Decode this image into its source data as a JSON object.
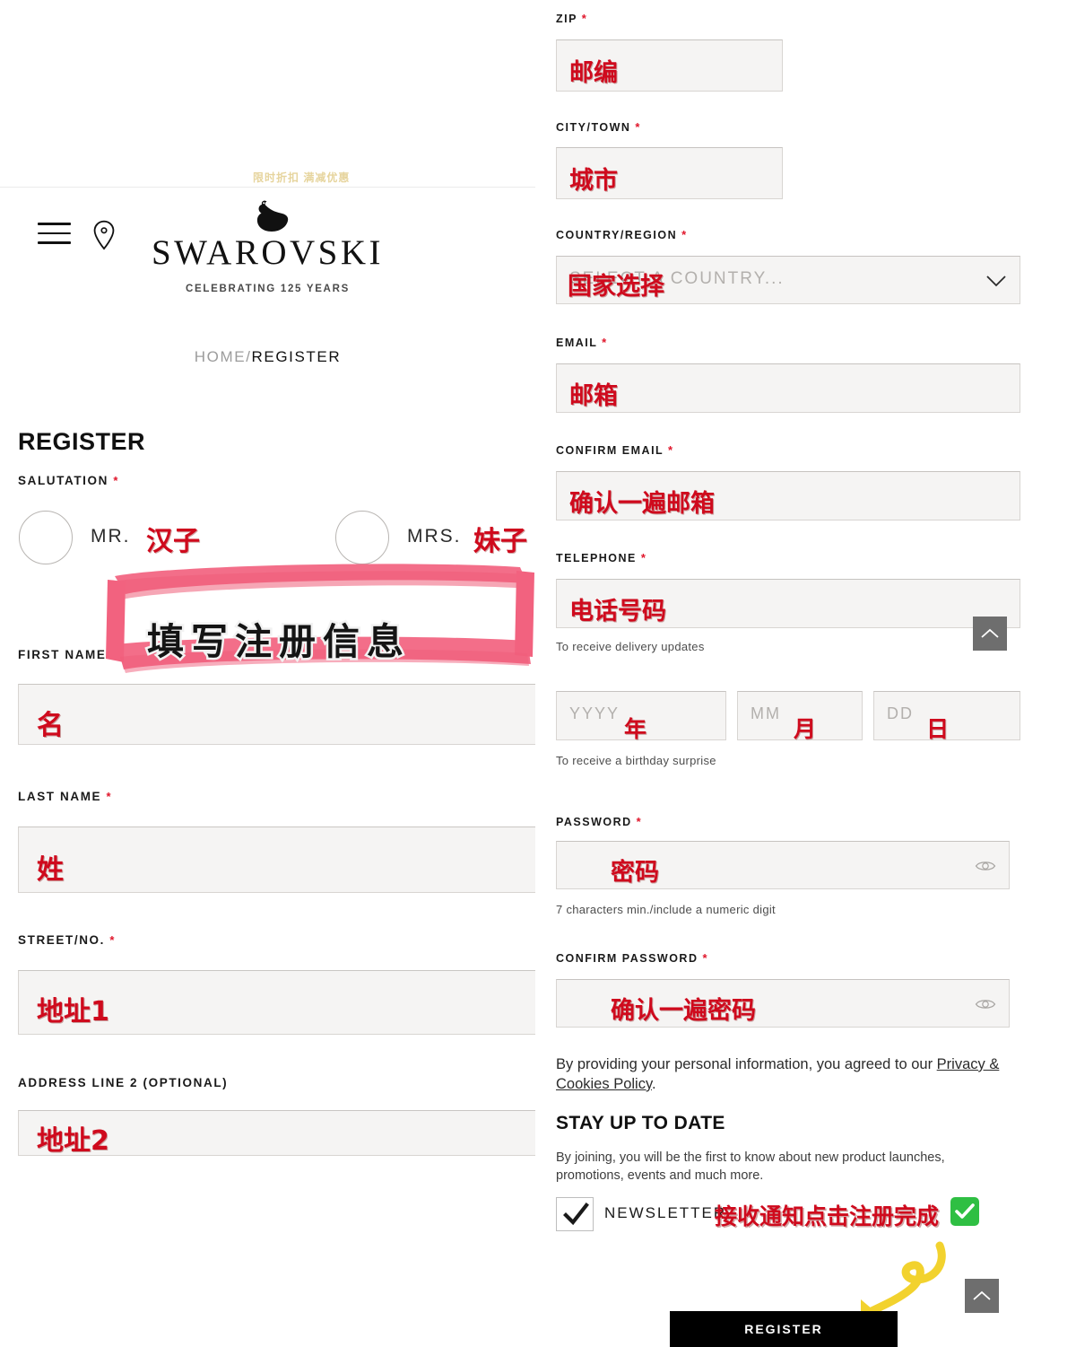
{
  "brand": {
    "name": "SWAROVSKI",
    "tagline": "CELEBRATING 125 YEARS",
    "faded_top_text": "限时折扣 满减优惠",
    "swan_icon": "swan-logo-icon",
    "menu_icon": "hamburger-menu-icon",
    "store_locator_icon": "map-pin-icon"
  },
  "breadcrumb": {
    "home": "HOME",
    "separator": "/",
    "current": "REGISTER"
  },
  "page": {
    "title": "REGISTER"
  },
  "salutation": {
    "label": "SALUTATION",
    "required_mark": "*",
    "options": [
      {
        "label": "MR.",
        "annotation": "汉子"
      },
      {
        "label": "MRS.",
        "annotation": "妹子"
      }
    ]
  },
  "annotations": {
    "brush_banner": "填写注册信息",
    "newsletter_note": "接收通知点击注册完成",
    "arrow_icon": "yellow-curved-arrow-icon",
    "green_check_icon": "green-check-icon"
  },
  "left_fields": [
    {
      "label": "FIRST NAME",
      "required_mark": "*",
      "value": "名"
    },
    {
      "label": "LAST NAME",
      "required_mark": "*",
      "value": "姓"
    },
    {
      "label": "STREET/NO.",
      "required_mark": "*",
      "value": "地址1"
    },
    {
      "label": "ADDRESS LINE 2  (OPTIONAL)",
      "required_mark": "",
      "value": "地址2"
    }
  ],
  "right_fields": {
    "zip": {
      "label": "ZIP",
      "required_mark": "*",
      "value": "邮编"
    },
    "city": {
      "label": "CITY/TOWN",
      "required_mark": "*",
      "value": "城市"
    },
    "country": {
      "label": "COUNTRY/REGION",
      "required_mark": "*",
      "placeholder": "SELECT A COUNTRY...",
      "value": "国家选择",
      "chevron_icon": "chevron-down-icon"
    },
    "email": {
      "label": "EMAIL",
      "required_mark": "*",
      "value": "邮箱"
    },
    "confirm_email": {
      "label": "CONFIRM EMAIL",
      "required_mark": "*",
      "value": "确认一遍邮箱"
    },
    "telephone": {
      "label": "TELEPHONE",
      "required_mark": "*",
      "value": "电话号码",
      "helper": "To receive delivery updates"
    },
    "birthday": {
      "helper": "To receive a birthday surprise",
      "year": {
        "placeholder": "YYYY",
        "value": "年"
      },
      "month": {
        "placeholder": "MM",
        "value": "月"
      },
      "day": {
        "placeholder": "DD",
        "value": "日"
      }
    },
    "password": {
      "label": "PASSWORD",
      "required_mark": "*",
      "value": "密码",
      "helper": "7 characters min./include a numeric digit",
      "reveal_icon": "eye-icon"
    },
    "confirm_password": {
      "label": "CONFIRM PASSWORD",
      "required_mark": "*",
      "value": "确认一遍密码",
      "reveal_icon": "eye-icon"
    }
  },
  "policy": {
    "text_before": "By providing your personal information, you agreed to our ",
    "link": "Privacy & Cookies Policy",
    "text_after": "."
  },
  "stay_up_to_date": {
    "title": "STAY UP TO DATE",
    "body": "By joining, you will be the first to know about new product launches, promotions, events and much more.",
    "newsletter_label": "NEWSLETTER",
    "checkbox_icon": "checkmark-icon"
  },
  "actions": {
    "register_label": "REGISTER",
    "scroll_top_icon": "chevron-up-icon"
  },
  "colors": {
    "accent_red": "#cf0a1d",
    "brush_pink": "#f2627f",
    "button_black": "#000000",
    "input_bg": "#f5f4f3",
    "green": "#2fbf43",
    "arrow_yellow": "#f2d22e"
  }
}
